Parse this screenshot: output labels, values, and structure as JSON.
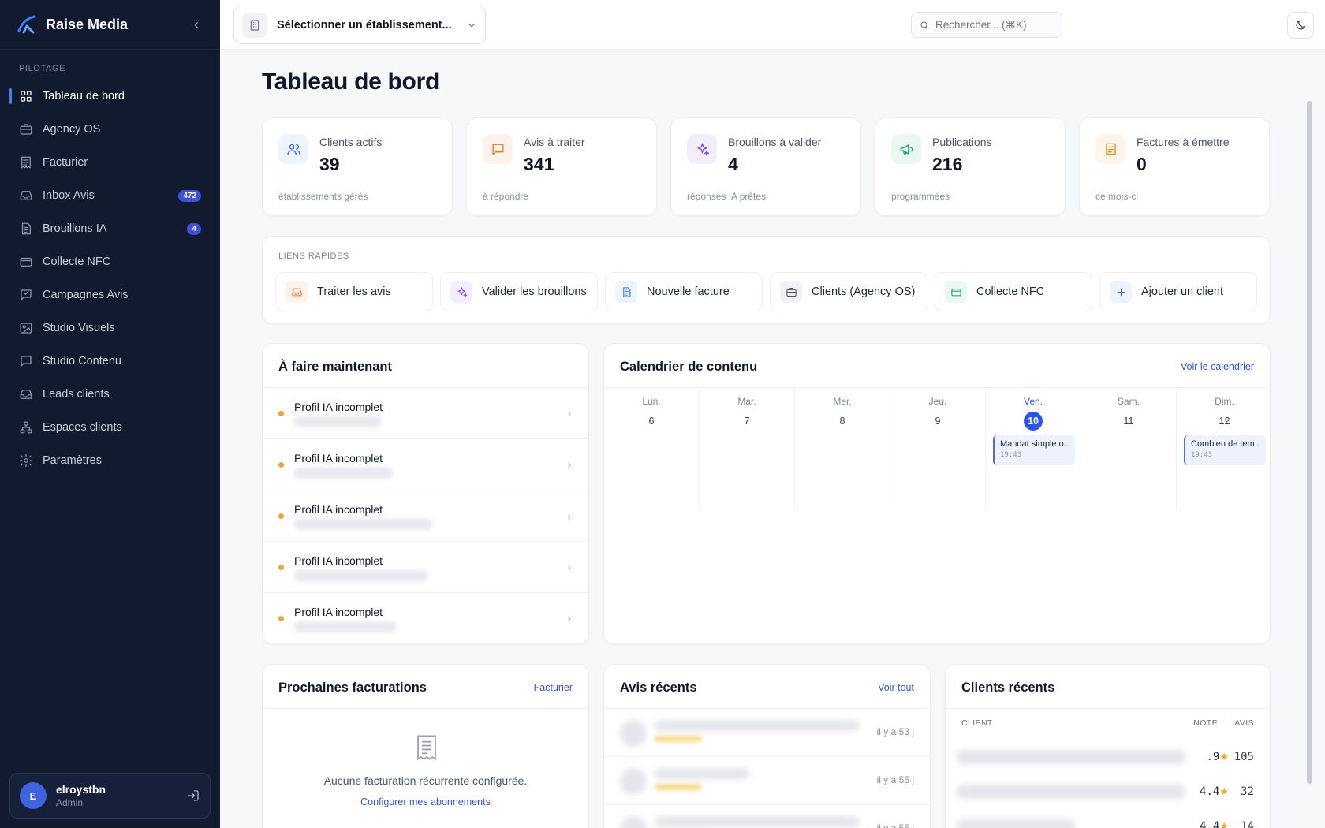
{
  "brand": {
    "name": "Raise Media"
  },
  "sidebar": {
    "section": "PILOTAGE",
    "items": [
      {
        "label": "Tableau de bord",
        "icon": "grid-icon",
        "active": true
      },
      {
        "label": "Agency OS",
        "icon": "briefcase-icon"
      },
      {
        "label": "Facturier",
        "icon": "receipt-icon"
      },
      {
        "label": "Inbox Avis",
        "icon": "inbox-icon",
        "badge": "472"
      },
      {
        "label": "Brouillons IA",
        "icon": "document-icon",
        "badge": "4"
      },
      {
        "label": "Collecte NFC",
        "icon": "card-icon"
      },
      {
        "label": "Campagnes Avis",
        "icon": "message-square-icon"
      },
      {
        "label": "Studio Visuels",
        "icon": "image-icon"
      },
      {
        "label": "Studio Contenu",
        "icon": "chat-icon"
      },
      {
        "label": "Leads clients",
        "icon": "inbox-icon"
      },
      {
        "label": "Espaces clients",
        "icon": "network-icon"
      },
      {
        "label": "Paramètres",
        "icon": "gear-icon"
      }
    ]
  },
  "user": {
    "initial": "E",
    "name": "elroystbn",
    "role": "Admin"
  },
  "topbar": {
    "establishment_placeholder": "Sélectionner un établissement...",
    "search_placeholder": "Rechercher... (⌘K)"
  },
  "page": {
    "title": "Tableau de bord"
  },
  "stats": [
    {
      "label": "Clients actifs",
      "value": "39",
      "sub": "établissements gérés",
      "icon": "users-icon",
      "color": "#3b6fe0",
      "bg": "#eef3ff"
    },
    {
      "label": "Avis à traiter",
      "value": "341",
      "sub": "à répondre",
      "icon": "message-icon",
      "color": "#e8742b",
      "bg": "#fff2ea"
    },
    {
      "label": "Brouillons à valider",
      "value": "4",
      "sub": "réponses IA prêtes",
      "icon": "sparkles-icon",
      "color": "#7c4ddb",
      "bg": "#f3eefe"
    },
    {
      "label": "Publications",
      "value": "216",
      "sub": "programmées",
      "icon": "megaphone-icon",
      "color": "#1e9e6a",
      "bg": "#eaf8f1"
    },
    {
      "label": "Factures à émettre",
      "value": "0",
      "sub": "ce mois-ci",
      "icon": "receipt-icon",
      "color": "#e08a1e",
      "bg": "#fff5e8"
    }
  ],
  "quick_links": {
    "title": "LIENS RAPIDES",
    "items": [
      {
        "label": "Traiter les avis",
        "icon": "inbox-icon",
        "color": "#e8742b",
        "bg": "#fff2ea"
      },
      {
        "label": "Valider les brouillons",
        "icon": "sparkles-icon",
        "color": "#7c4ddb",
        "bg": "#f3eefe"
      },
      {
        "label": "Nouvelle facture",
        "icon": "document-icon",
        "color": "#3b6fe0",
        "bg": "#eef3ff"
      },
      {
        "label": "Clients (Agency OS)",
        "icon": "briefcase-icon",
        "color": "#4b5563",
        "bg": "#f1f2f5"
      },
      {
        "label": "Collecte NFC",
        "icon": "card-icon",
        "color": "#1e9e6a",
        "bg": "#eaf8f1"
      },
      {
        "label": "Ajouter un client",
        "icon": "plus-icon",
        "color": "#3b6fe0",
        "bg": "#eef3ff"
      }
    ]
  },
  "todo": {
    "title": "À faire maintenant",
    "items": [
      {
        "label": "Profil IA incomplet"
      },
      {
        "label": "Profil IA incomplet"
      },
      {
        "label": "Profil IA incomplet"
      },
      {
        "label": "Profil IA incomplet"
      },
      {
        "label": "Profil IA incomplet"
      }
    ]
  },
  "calendar": {
    "title": "Calendrier de contenu",
    "link": "Voir le calendrier",
    "days": [
      {
        "name": "Lun.",
        "num": "6"
      },
      {
        "name": "Mar.",
        "num": "7"
      },
      {
        "name": "Mer.",
        "num": "8"
      },
      {
        "name": "Jeu.",
        "num": "9"
      },
      {
        "name": "Ven.",
        "num": "10",
        "today": true,
        "event": {
          "title": "Mandat simple o...",
          "time": "19:43"
        }
      },
      {
        "name": "Sam.",
        "num": "11"
      },
      {
        "name": "Dim.",
        "num": "12",
        "event": {
          "title": "Combien de tem...",
          "time": "19:43"
        }
      }
    ]
  },
  "billing": {
    "title": "Prochaines facturations",
    "link": "Facturier",
    "empty": "Aucune facturation récurrente configurée.",
    "config": "Configurer mes abonnements"
  },
  "reviews": {
    "title": "Avis récents",
    "link": "Voir tout",
    "items": [
      {
        "time": "il y a 53 j"
      },
      {
        "time": "il y a 55 j"
      },
      {
        "time": "il y a 55 j"
      }
    ]
  },
  "clients": {
    "title": "Clients récents",
    "col_client": "CLIENT",
    "col_note": "NOTE",
    "col_avis": "AVIS",
    "items": [
      {
        "note": ".9",
        "avis": "105"
      },
      {
        "note": "4.4",
        "avis": "32"
      },
      {
        "note": "4.4",
        "avis": "14"
      }
    ]
  }
}
